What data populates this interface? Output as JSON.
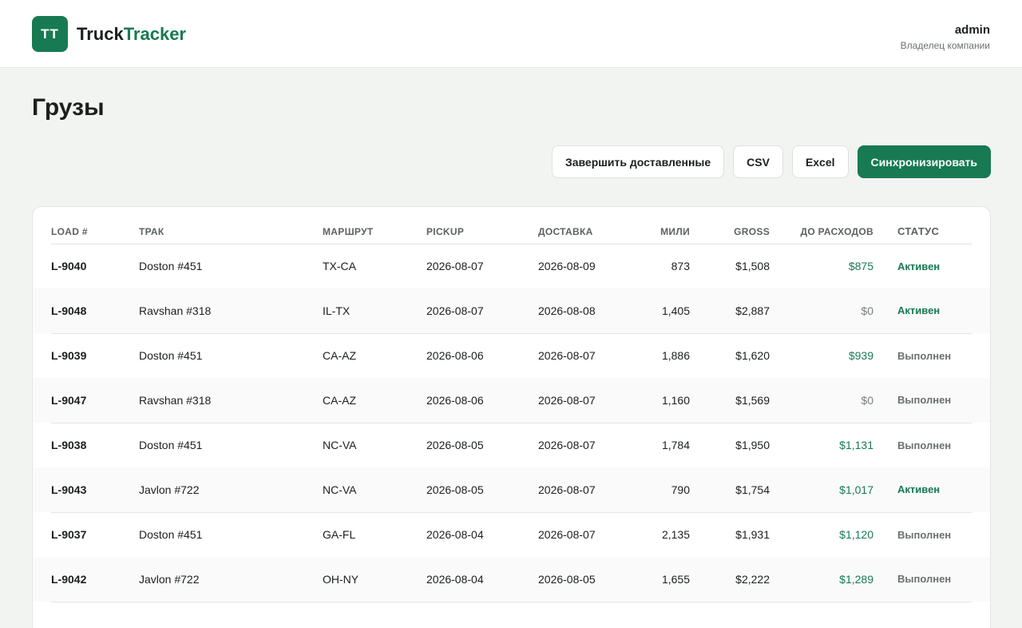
{
  "brand": {
    "initials": "TT",
    "part1": "Truck",
    "part2": "Tracker"
  },
  "user": {
    "name": "admin",
    "role": "Владелец компании"
  },
  "page": {
    "title": "Грузы"
  },
  "actions": {
    "complete_delivered": "Завершить доставленные",
    "csv": "CSV",
    "excel": "Excel",
    "sync": "Синхронизировать"
  },
  "table": {
    "headers": {
      "load": "LOAD #",
      "truck": "ТРАК",
      "route": "МАРШРУТ",
      "pickup": "PICKUP",
      "delivery": "ДОСТАВКА",
      "miles": "МИЛИ",
      "gross": "GROSS",
      "net": "ДО РАСХОДОВ",
      "status": "СТАТУС"
    },
    "rows": [
      {
        "load": "L-9040",
        "truck": "Doston #451",
        "route": "TX-CA",
        "pickup": "2026-08-07",
        "delivery": "2026-08-09",
        "miles": "873",
        "gross": "$1,508",
        "net": "$875",
        "status": "Активен"
      },
      {
        "load": "L-9048",
        "truck": "Ravshan #318",
        "route": "IL-TX",
        "pickup": "2026-08-07",
        "delivery": "2026-08-08",
        "miles": "1,405",
        "gross": "$2,887",
        "net": "$0",
        "status": "Активен"
      },
      {
        "load": "L-9039",
        "truck": "Doston #451",
        "route": "CA-AZ",
        "pickup": "2026-08-06",
        "delivery": "2026-08-07",
        "miles": "1,886",
        "gross": "$1,620",
        "net": "$939",
        "status": "Выполнен"
      },
      {
        "load": "L-9047",
        "truck": "Ravshan #318",
        "route": "CA-AZ",
        "pickup": "2026-08-06",
        "delivery": "2026-08-07",
        "miles": "1,160",
        "gross": "$1,569",
        "net": "$0",
        "status": "Выполнен"
      },
      {
        "load": "L-9038",
        "truck": "Doston #451",
        "route": "NC-VA",
        "pickup": "2026-08-05",
        "delivery": "2026-08-07",
        "miles": "1,784",
        "gross": "$1,950",
        "net": "$1,131",
        "status": "Выполнен"
      },
      {
        "load": "L-9043",
        "truck": "Javlon #722",
        "route": "NC-VA",
        "pickup": "2026-08-05",
        "delivery": "2026-08-07",
        "miles": "790",
        "gross": "$1,754",
        "net": "$1,017",
        "status": "Активен"
      },
      {
        "load": "L-9037",
        "truck": "Doston #451",
        "route": "GA-FL",
        "pickup": "2026-08-04",
        "delivery": "2026-08-07",
        "miles": "2,135",
        "gross": "$1,931",
        "net": "$1,120",
        "status": "Выполнен"
      },
      {
        "load": "L-9042",
        "truck": "Javlon #722",
        "route": "OH-NY",
        "pickup": "2026-08-04",
        "delivery": "2026-08-05",
        "miles": "1,655",
        "gross": "$2,222",
        "net": "$1,289",
        "status": "Выполнен"
      }
    ]
  },
  "colors": {
    "accent": "#177a52",
    "background": "#f2f4f2",
    "muted": "#6b716d"
  }
}
